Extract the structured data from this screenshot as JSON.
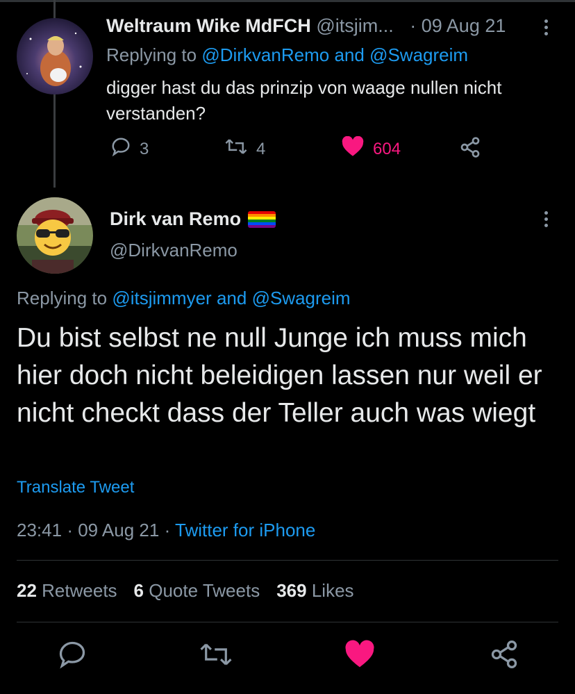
{
  "tweet1": {
    "display_name": "Weltraum Wike MdFCH",
    "handle": "@itsjim...",
    "separator": "·",
    "date": "09 Aug 21",
    "replying_prefix": "Replying to",
    "replying_user1": "@DirkvanRemo",
    "replying_and": "and",
    "replying_user2": "@Swagreim",
    "text": "digger hast du das prinzip von waage nullen nicht verstanden?",
    "reply_count": "3",
    "retweet_count": "4",
    "like_count": "604",
    "like_color": "#f91880"
  },
  "tweet2": {
    "display_name": "Dirk van Remo",
    "handle": "@DirkvanRemo",
    "replying_prefix": "Replying to",
    "replying_user1": "@itsjimmyer",
    "replying_and": "and",
    "replying_user2": "@Swagreim",
    "text": "Du bist selbst ne null Junge ich muss mich hier doch nicht beleidigen lassen nur weil er nicht checkt dass der Teller auch was wiegt",
    "translate_label": "Translate Tweet",
    "time": "23:41",
    "date": "09 Aug 21",
    "source": "Twitter for iPhone",
    "retweets_count": "22",
    "retweets_label": "Retweets",
    "quotes_count": "6",
    "quotes_label": "Quote Tweets",
    "likes_count": "369",
    "likes_label": "Likes"
  },
  "colors": {
    "background": "#000000",
    "accent": "#1d9bf0",
    "muted": "#8b98a5",
    "like": "#f91880"
  },
  "icons": [
    "more-icon",
    "reply-icon",
    "retweet-icon",
    "like-icon",
    "share-icon",
    "rainbow-flag-icon"
  ]
}
